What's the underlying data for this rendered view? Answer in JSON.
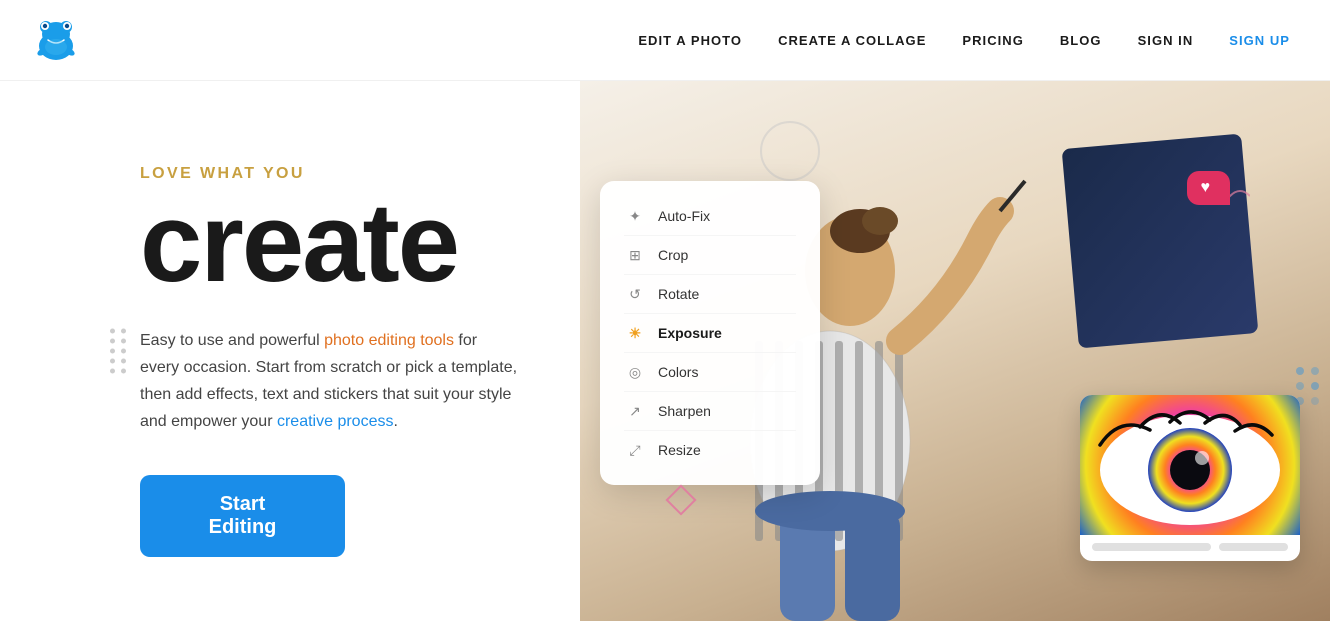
{
  "header": {
    "logo_alt": "BeFunky Logo",
    "nav": {
      "edit_photo": "EDIT A PHOTO",
      "create_collage": "CREATE A COLLAGE",
      "pricing": "PRICING",
      "blog": "BLOG",
      "sign_in": "SIGN IN",
      "sign_up": "SIGN UP"
    }
  },
  "hero": {
    "tagline_top": "LOVE WHAT YOU",
    "title": "create",
    "description_part1": "Easy to use and powerful ",
    "description_highlight1": "photo editing tools",
    "description_part2": " for every occasion. Start from scratch or pick a template, then add effects, text and stickers that suit your style and empower your ",
    "description_highlight2": "creative process",
    "description_part3": ".",
    "cta_button": "Start Editing"
  },
  "edit_menu": {
    "items": [
      {
        "label": "Auto-Fix",
        "icon": "✦"
      },
      {
        "label": "Crop",
        "icon": "⊞"
      },
      {
        "label": "Rotate",
        "icon": "↺"
      },
      {
        "label": "Exposure",
        "icon": "☀",
        "active": true
      },
      {
        "label": "Colors",
        "icon": "◎"
      },
      {
        "label": "Sharpen",
        "icon": "↗"
      },
      {
        "label": "Resize",
        "icon": "⤢"
      }
    ]
  },
  "heart_bubble": {
    "count": ""
  },
  "colors": {
    "primary_blue": "#1a8de9",
    "tagline_gold": "#c8a040",
    "orange_highlight": "#e07020",
    "heart_red": "#e03060"
  }
}
